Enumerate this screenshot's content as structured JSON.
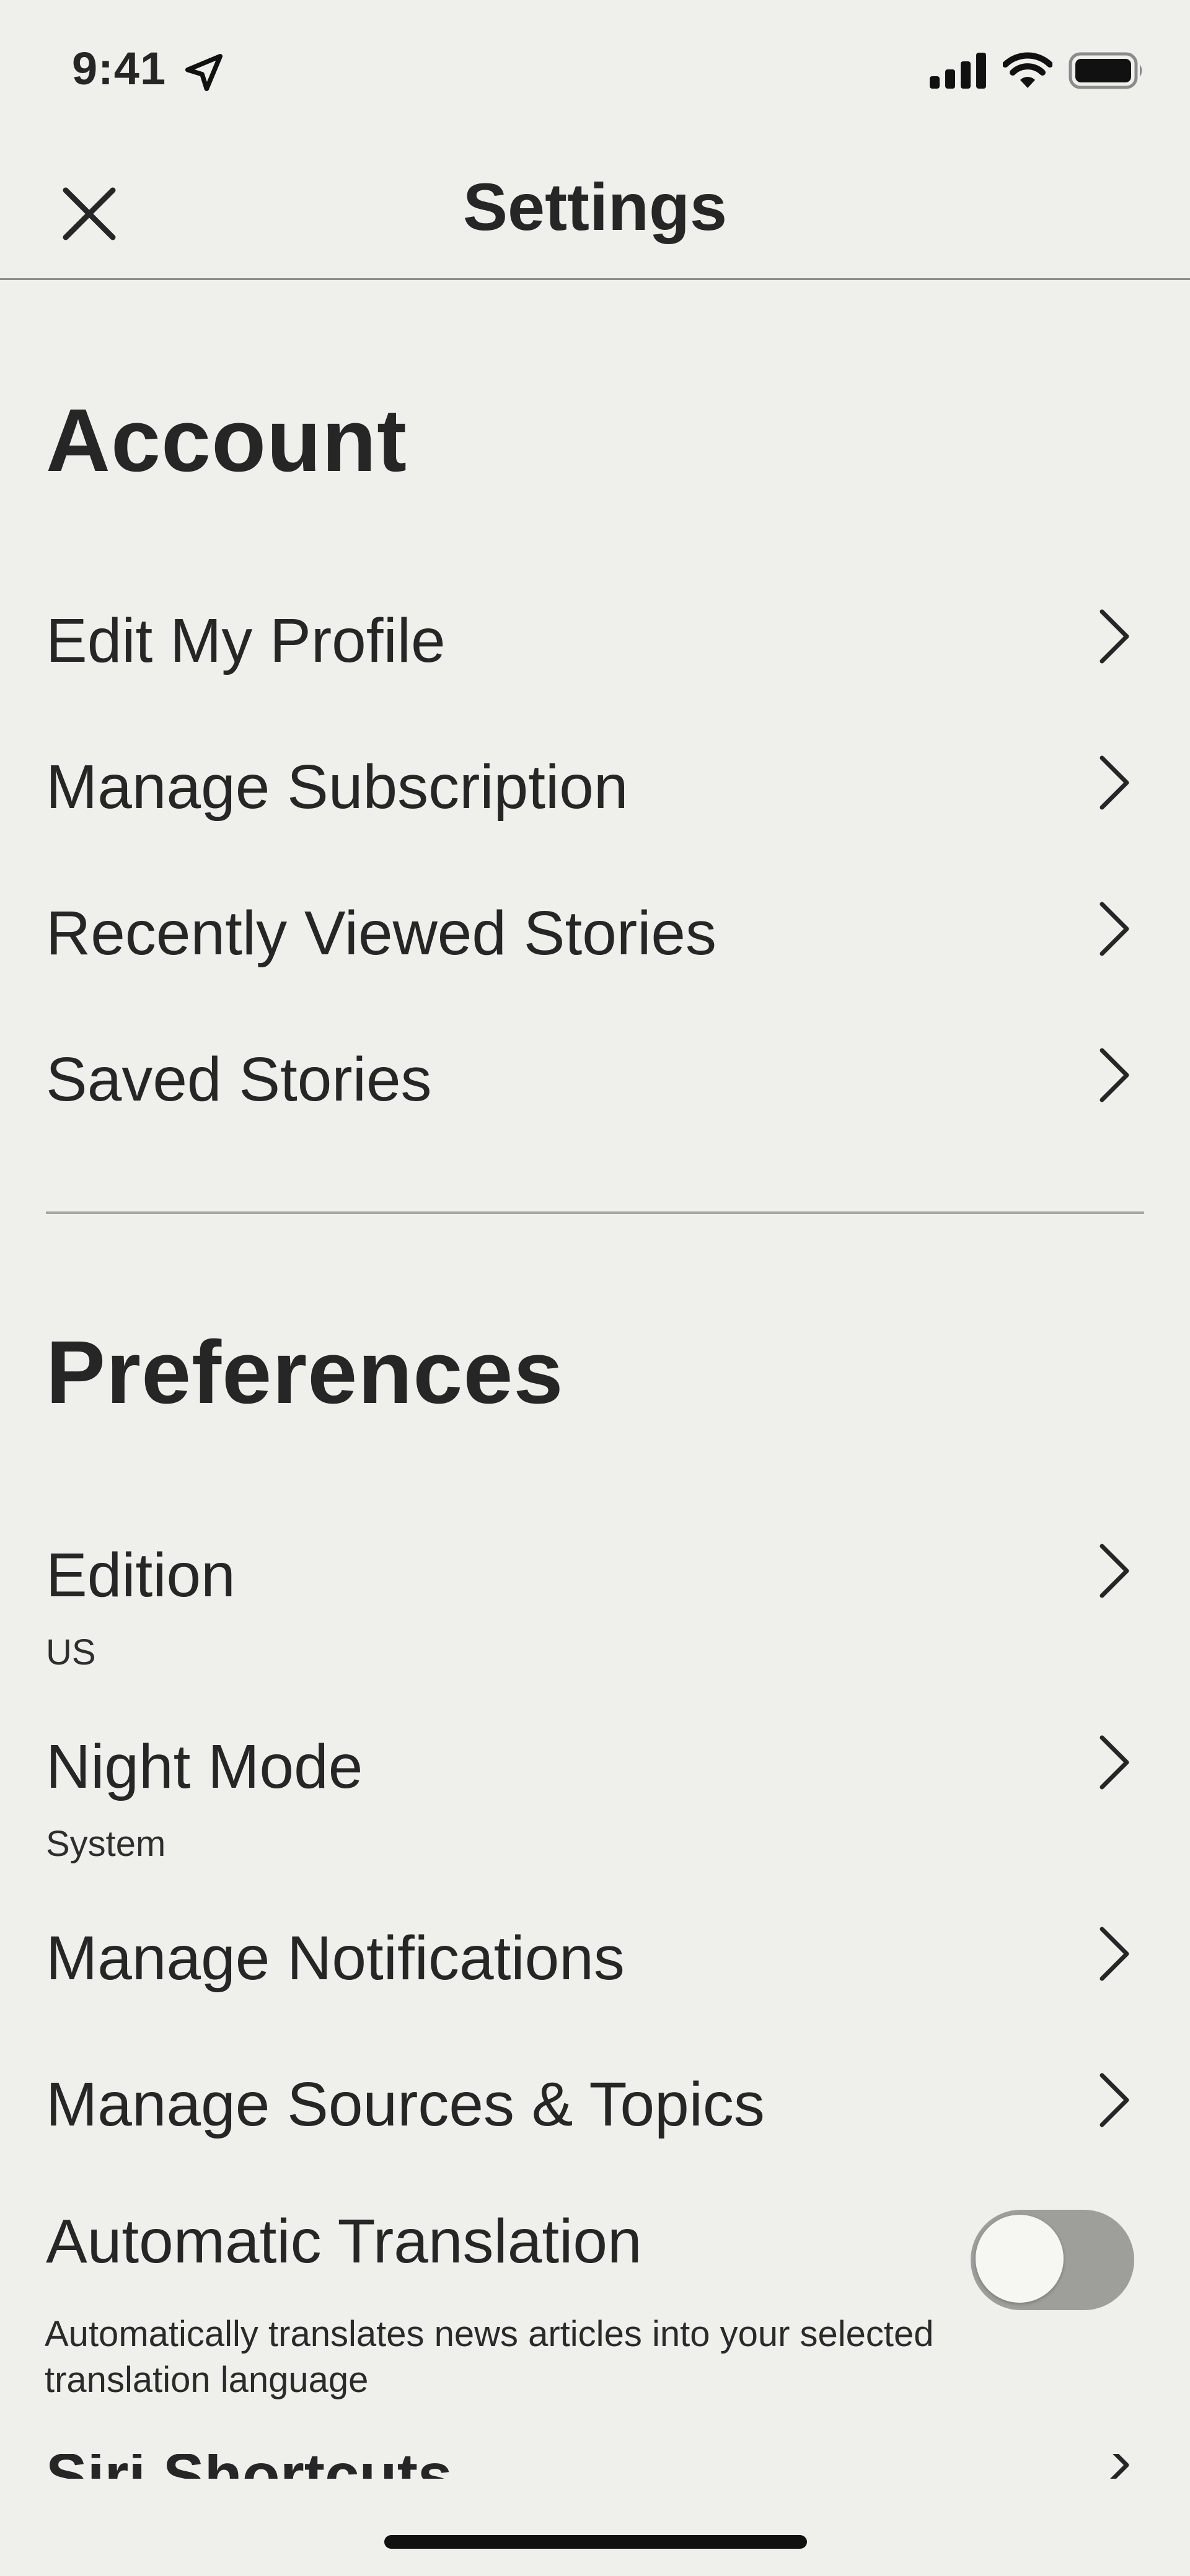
{
  "status_bar": {
    "time": "9:41",
    "icons": [
      "location-arrow-icon",
      "cellular-signal-icon",
      "wifi-icon",
      "battery-icon"
    ]
  },
  "nav": {
    "title": "Settings",
    "close_icon": "close-icon"
  },
  "account": {
    "title": "Account",
    "items": [
      {
        "label": "Edit My Profile"
      },
      {
        "label": "Manage Subscription"
      },
      {
        "label": "Recently Viewed Stories"
      },
      {
        "label": "Saved Stories"
      }
    ]
  },
  "preferences": {
    "title": "Preferences",
    "items": [
      {
        "label": "Edition",
        "value": "US"
      },
      {
        "label": "Night Mode",
        "value": "System"
      },
      {
        "label": "Manage Notifications"
      },
      {
        "label": "Manage Sources & Topics"
      }
    ],
    "automatic_translation": {
      "label": "Automatic Translation",
      "description": "Automatically translates news articles into your selected translation language",
      "enabled": false
    },
    "clipped_item": {
      "label": "Siri Shortcuts"
    }
  },
  "colors": {
    "background": "#efefeb",
    "text": "#262626",
    "toggle_off": "#9e9e9b"
  }
}
